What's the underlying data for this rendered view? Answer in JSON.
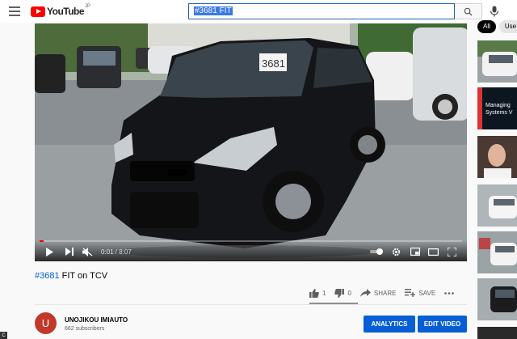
{
  "header": {
    "logo_text": "YouTube",
    "logo_country": "JP",
    "search_value": "#3681 FIT"
  },
  "player": {
    "time_display": "0:01 / 8:07",
    "plate_text": "3681",
    "progress": 0.002
  },
  "video": {
    "title_tag": "#3681",
    "title_rest": " FIT on TCV",
    "likes": "1",
    "dislikes": "0",
    "share_label": "SHARE",
    "save_label": "SAVE"
  },
  "channel": {
    "avatar_letter": "U",
    "name": "UNOJIKOU IMIAUTO",
    "subscribers": "662 subscribers",
    "analytics_label": "ANALYTICS",
    "edit_label": "EDIT VIDEO"
  },
  "sidebar": {
    "chips": [
      "All",
      "Use"
    ],
    "thumb2_text1": "Managing",
    "thumb2_text2": "Systems V"
  },
  "corner_badge": "C"
}
